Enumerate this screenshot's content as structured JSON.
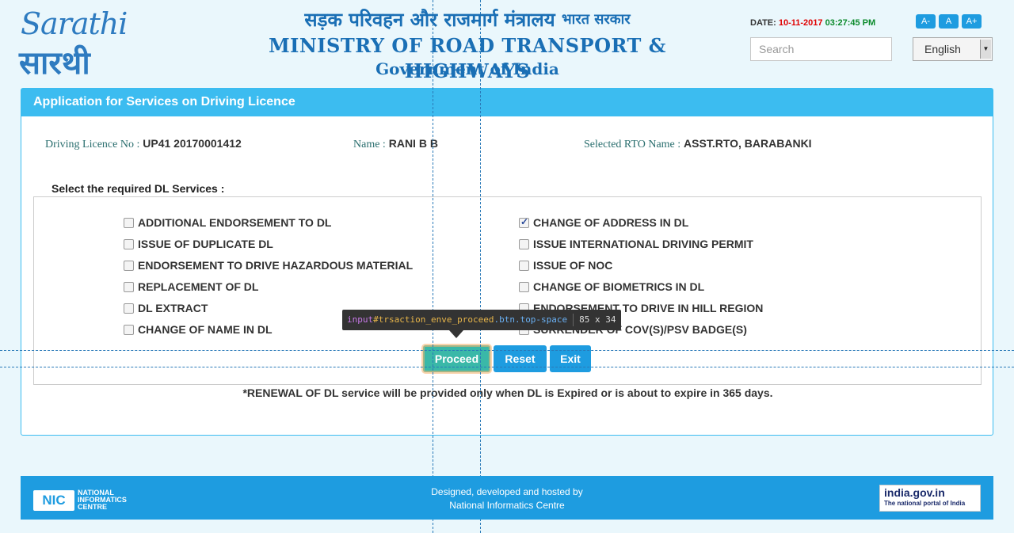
{
  "header": {
    "logo_latin": "Sarathi",
    "logo_hindi": "सारथी",
    "hindi_title": "सड़क परिवहन और राजमार्ग मंत्रालय",
    "hindi_sub": "भारत सरकार",
    "english_title": "MINISTRY OF ROAD TRANSPORT & HIGHWAYS",
    "gov_title": "Government of India",
    "date_label": "DATE:",
    "date": "10-11-2017",
    "time": "03:27:45 PM",
    "font_small": "A-",
    "font_normal": "A",
    "font_large": "A+",
    "search_placeholder": "Search",
    "language": "English"
  },
  "panel": {
    "title": "Application for Services on Driving Licence",
    "dl_label": "Driving Licence No :",
    "dl_value": "UP41 20170001412",
    "name_label": "Name :",
    "name_value": "RANI B B",
    "rto_label": "Selected RTO Name :",
    "rto_value": "ASST.RTO, BARABANKI",
    "legend": "Select the required DL Services :",
    "left_options": [
      {
        "label": "ADDITIONAL ENDORSEMENT TO DL",
        "checked": false
      },
      {
        "label": "ISSUE OF DUPLICATE DL",
        "checked": false
      },
      {
        "label": "ENDORSEMENT TO DRIVE HAZARDOUS MATERIAL",
        "checked": false
      },
      {
        "label": "REPLACEMENT OF DL",
        "checked": false
      },
      {
        "label": "DL EXTRACT",
        "checked": false
      },
      {
        "label": "CHANGE OF NAME IN DL",
        "checked": false
      }
    ],
    "right_options": [
      {
        "label": "CHANGE OF ADDRESS IN DL",
        "checked": true
      },
      {
        "label": "ISSUE INTERNATIONAL DRIVING PERMIT",
        "checked": false
      },
      {
        "label": "ISSUE OF NOC",
        "checked": false
      },
      {
        "label": "CHANGE OF BIOMETRICS IN DL",
        "checked": false
      },
      {
        "label": "ENDORSEMENT TO DRIVE IN HILL REGION",
        "checked": false
      },
      {
        "label": "SURRENDER OF COV(S)/PSV BADGE(S)",
        "checked": false
      }
    ],
    "buttons": {
      "proceed": "Proceed",
      "reset": "Reset",
      "exit": "Exit"
    },
    "note": "*RENEWAL OF DL service will be provided only when DL is Expired or is about to expire in 365 days."
  },
  "devtools_tooltip": {
    "tag": "input",
    "id": "#trsaction_enve_proceed",
    "classes": ".btn.top-space",
    "size": "85 x 34"
  },
  "footer": {
    "nic_mark": "NIC",
    "nic_text": "NATIONAL INFORMATICS CENTRE",
    "line1": "Designed, developed and hosted by",
    "line2": "National Informatics Centre",
    "indiagov_title": "india.gov.in",
    "indiagov_sub": "The national portal of India"
  },
  "colors": {
    "accent": "#3cbcf0",
    "button": "#1e9ce0",
    "date": "#e00000",
    "time": "#0a8a2a",
    "highlight": "#3ab8a8"
  }
}
